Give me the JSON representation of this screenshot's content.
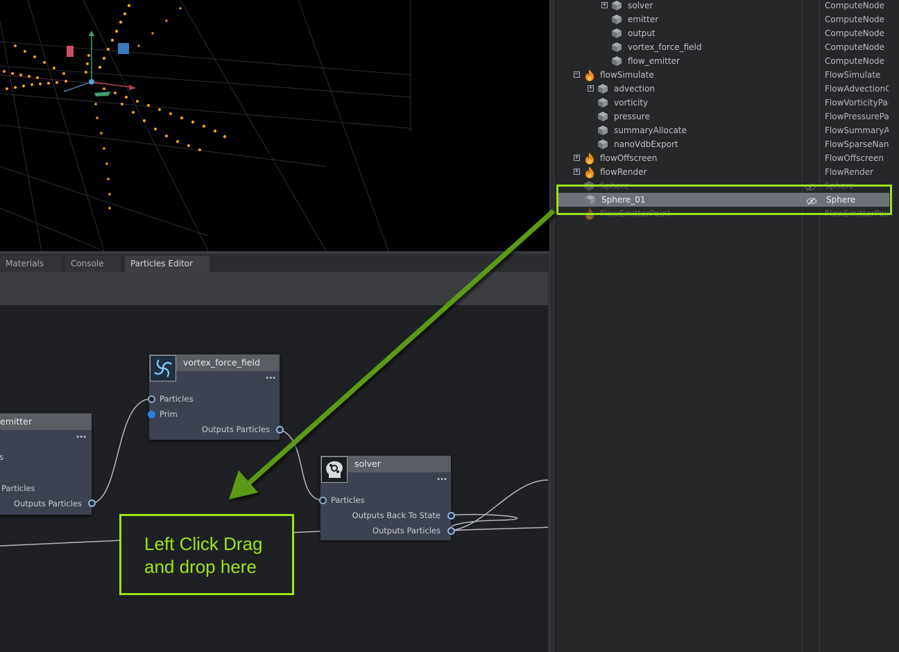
{
  "tabs": [
    {
      "label": "Materials"
    },
    {
      "label": "Console"
    },
    {
      "label": "Particles Editor",
      "active": true
    }
  ],
  "nodes": {
    "emitter": {
      "title": "emitter",
      "ports": [
        "es",
        "Particles",
        "Outputs Particles"
      ]
    },
    "vortex": {
      "title": "vortex_force_field",
      "ports": [
        "Particles",
        "Prim",
        "Outputs Particles"
      ]
    },
    "solver": {
      "title": "solver",
      "ports": [
        "Particles",
        "Outputs Back To State",
        "Outputs Particles"
      ]
    },
    "more_glyph": "•••"
  },
  "outliner": {
    "rows": [
      {
        "name": "solver",
        "type": "ComputeNode",
        "indent": 3,
        "expander": "+",
        "icon": "cube-icon"
      },
      {
        "name": "emitter",
        "type": "ComputeNode",
        "indent": 3,
        "icon": "cube-icon"
      },
      {
        "name": "output",
        "type": "ComputeNode",
        "indent": 3,
        "icon": "cube-icon"
      },
      {
        "name": "vortex_force_field",
        "type": "ComputeNode",
        "indent": 3,
        "icon": "cube-icon"
      },
      {
        "name": "flow_emitter",
        "type": "ComputeNode",
        "indent": 3,
        "icon": "cube-icon"
      },
      {
        "name": "flowSimulate",
        "type": "FlowSimulate",
        "indent": 1,
        "expander": "−",
        "icon": "flame-icon"
      },
      {
        "name": "advection",
        "type": "FlowAdvectionC",
        "indent": 2,
        "expander": "+",
        "icon": "cube-icon"
      },
      {
        "name": "vorticity",
        "type": "FlowVorticityPar",
        "indent": 2,
        "icon": "cube-icon"
      },
      {
        "name": "pressure",
        "type": "FlowPressurePa",
        "indent": 2,
        "icon": "cube-icon"
      },
      {
        "name": "summaryAllocate",
        "type": "FlowSummaryAl",
        "indent": 2,
        "icon": "cube-icon"
      },
      {
        "name": "nanoVdbExport",
        "type": "FlowSparseNanc",
        "indent": 2,
        "icon": "cube-icon"
      },
      {
        "name": "flowOffscreen",
        "type": "FlowOffscreen",
        "indent": 1,
        "expander": "+",
        "icon": "flame-icon"
      },
      {
        "name": "flowRender",
        "type": "FlowRender",
        "indent": 1,
        "expander": "+",
        "icon": "flame-icon"
      },
      {
        "name": "Sphere",
        "type": "Sphere",
        "indent": 1,
        "icon": "cube-icon",
        "dim": true
      },
      {
        "name": "Sphere_01",
        "type": "Sphere",
        "indent": 1,
        "icon": "cube-icon",
        "selected": true
      },
      {
        "name": "FlowEmitterPoint",
        "type": "FlowEmitterPoin",
        "indent": 1,
        "icon": "flame-icon",
        "dim": true
      }
    ]
  },
  "annotation": {
    "drop_text": "Left Click Drag\nand drop here",
    "accent_color": "#9be31c",
    "arrow_color": "#5c9a12"
  }
}
